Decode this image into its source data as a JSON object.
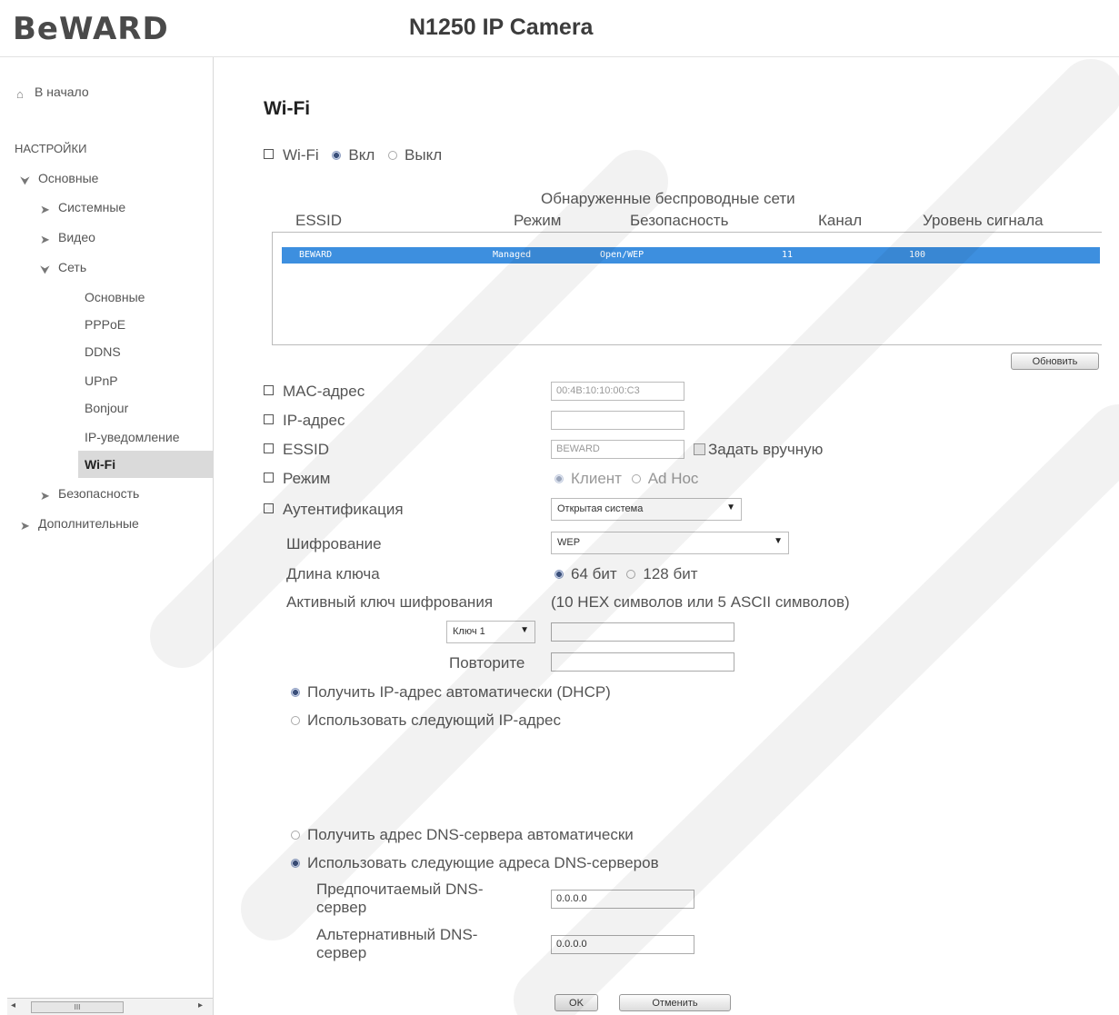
{
  "header": {
    "logo": "BeWARD",
    "title": "N1250 IP Camera"
  },
  "sidebar": {
    "home": "В начало",
    "section": "НАСТРОЙКИ",
    "items": [
      {
        "label": "Основные"
      },
      {
        "label": "Системные"
      },
      {
        "label": "Видео"
      },
      {
        "label": "Сеть"
      },
      {
        "label": "Основные"
      },
      {
        "label": "PPPoE"
      },
      {
        "label": "DDNS"
      },
      {
        "label": "UPnP"
      },
      {
        "label": "Bonjour"
      },
      {
        "label": "IP-уведомление"
      },
      {
        "label": "Wi-Fi"
      },
      {
        "label": "Безопасность"
      },
      {
        "label": "Дополнительные"
      }
    ],
    "scroll_thumb": "III"
  },
  "page": {
    "title": "Wi-Fi",
    "wifi_label": "Wi-Fi",
    "on_label": "Вкл",
    "off_label": "Выкл",
    "networks_caption": "Обнаруженные беспроводные сети",
    "columns": [
      "ESSID",
      "Режим",
      "Безопасность",
      "Канал",
      "Уровень сигнала"
    ],
    "networks": [
      {
        "essid": "BEWARD",
        "mode": "Managed",
        "security": "Open/WEP",
        "channel": "11",
        "signal": "100"
      }
    ],
    "refresh_button": "Обновить",
    "mac_label": "MAC-адрес",
    "mac_value": "00:4B:10:10:00:C3",
    "ip_label": "IP-адрес",
    "ip_value": "",
    "essid_label": "ESSID",
    "essid_value": "BEWARD",
    "manual_label": "Задать вручную",
    "mode_label": "Режим",
    "mode_client": "Клиент",
    "mode_adhoc": "Ad Hoc",
    "auth_label": "Аутентификация",
    "auth_value": "Открытая система",
    "enc_label": "Шифрование",
    "enc_value": "WEP",
    "keylen_label": "Длина ключа",
    "keylen_64": "64 бит",
    "keylen_128": "128 бит",
    "active_key_label": "Активный ключ шифрования",
    "active_key_hint": "(10 HEX символов или 5 ASCII символов)",
    "key_select": "Ключ 1",
    "key_value": "",
    "repeat_label": "Повторите",
    "repeat_value": "",
    "dhcp_label": "Получить IP-адрес автоматически (DHCP)",
    "static_ip_label": "Использовать следующий IP-адрес",
    "dns_auto_label": "Получить адрес DNS-сервера автоматически",
    "dns_manual_label": "Использовать следующие адреса DNS-серверов",
    "dns_pref_label_1": "Предпочитаемый DNS-",
    "dns_pref_label_2": "сервер",
    "dns_pref_value": "0.0.0.0",
    "dns_alt_label_1": "Альтернативный DNS-",
    "dns_alt_label_2": "сервер",
    "dns_alt_value": "0.0.0.0",
    "ok_button": "OK",
    "cancel_button": "Отменить"
  },
  "colors": {
    "selected_row": "#3d8fdf",
    "active_nav": "#dadada"
  }
}
